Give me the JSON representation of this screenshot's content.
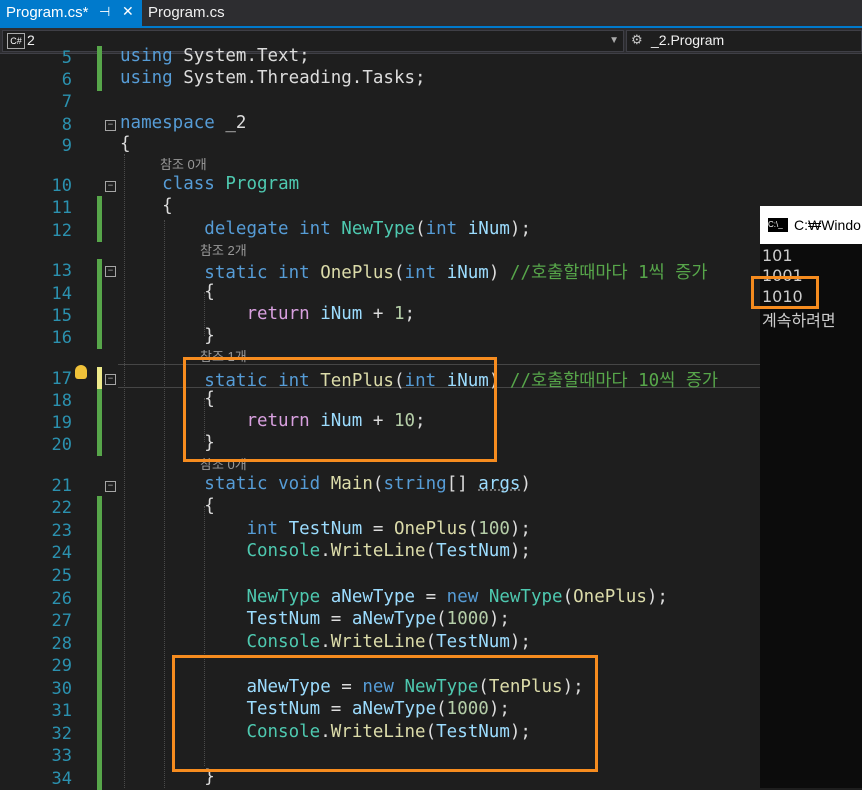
{
  "tabs": [
    {
      "label": "Program.cs*",
      "pin": "⊣",
      "close": "✕"
    },
    {
      "label": "Program.cs"
    }
  ],
  "nav": {
    "project_icon": "C#",
    "project": "2",
    "class_icon": "class-icon",
    "class_name": "_2.Program"
  },
  "lines": [
    {
      "n": "5",
      "parts": [
        [
          "kw",
          "using"
        ],
        [
          "plain",
          " System.Text;"
        ]
      ]
    },
    {
      "n": "6",
      "parts": [
        [
          "kw",
          "using"
        ],
        [
          "plain",
          " System.Threading.Tasks;"
        ]
      ]
    },
    {
      "n": "7",
      "parts": []
    },
    {
      "n": "8",
      "parts": [
        [
          "kw",
          "namespace"
        ],
        [
          "plain",
          " _2"
        ]
      ]
    },
    {
      "n": "9",
      "parts": [
        [
          "plain",
          "{"
        ]
      ]
    },
    {
      "n": "10",
      "parts": [
        [
          "plain",
          "    "
        ],
        [
          "kw",
          "class"
        ],
        [
          "plain",
          " "
        ],
        [
          "ty",
          "Program"
        ]
      ]
    },
    {
      "n": "11",
      "parts": [
        [
          "plain",
          "    {"
        ]
      ]
    },
    {
      "n": "12",
      "parts": [
        [
          "plain",
          "        "
        ],
        [
          "kw",
          "delegate"
        ],
        [
          "plain",
          " "
        ],
        [
          "kw",
          "int"
        ],
        [
          "plain",
          " "
        ],
        [
          "ty",
          "NewType"
        ],
        [
          "plain",
          "("
        ],
        [
          "kw",
          "int"
        ],
        [
          "plain",
          " "
        ],
        [
          "pm",
          "iNum"
        ],
        [
          "plain",
          ");"
        ]
      ]
    },
    {
      "n": "13",
      "parts": [
        [
          "plain",
          "        "
        ],
        [
          "kw",
          "static"
        ],
        [
          "plain",
          " "
        ],
        [
          "kw",
          "int"
        ],
        [
          "plain",
          " "
        ],
        [
          "fn",
          "OnePlus"
        ],
        [
          "plain",
          "("
        ],
        [
          "kw",
          "int"
        ],
        [
          "plain",
          " "
        ],
        [
          "pm",
          "iNum"
        ],
        [
          "plain",
          ") "
        ],
        [
          "cm",
          "//호출할때마다 1씩 증가"
        ]
      ]
    },
    {
      "n": "14",
      "parts": [
        [
          "plain",
          "        {"
        ]
      ]
    },
    {
      "n": "15",
      "parts": [
        [
          "plain",
          "            "
        ],
        [
          "ctl",
          "return"
        ],
        [
          "plain",
          " "
        ],
        [
          "pm",
          "iNum"
        ],
        [
          "plain",
          " + "
        ],
        [
          "num",
          "1"
        ],
        [
          "plain",
          ";"
        ]
      ]
    },
    {
      "n": "16",
      "parts": [
        [
          "plain",
          "        }"
        ]
      ]
    },
    {
      "n": "17",
      "parts": [
        [
          "plain",
          "        "
        ],
        [
          "kw",
          "static"
        ],
        [
          "plain",
          " "
        ],
        [
          "kw",
          "int"
        ],
        [
          "plain",
          " "
        ],
        [
          "fn",
          "TenPlus"
        ],
        [
          "plain",
          "("
        ],
        [
          "kw",
          "int"
        ],
        [
          "plain",
          " "
        ],
        [
          "pm",
          "iNum"
        ],
        [
          "plain",
          ") "
        ],
        [
          "cm",
          "//호출할때마다 10씩 증가"
        ]
      ]
    },
    {
      "n": "18",
      "parts": [
        [
          "plain",
          "        {"
        ]
      ]
    },
    {
      "n": "19",
      "parts": [
        [
          "plain",
          "            "
        ],
        [
          "ctl",
          "return"
        ],
        [
          "plain",
          " "
        ],
        [
          "pm",
          "iNum"
        ],
        [
          "plain",
          " + "
        ],
        [
          "num",
          "10"
        ],
        [
          "plain",
          ";"
        ]
      ]
    },
    {
      "n": "20",
      "parts": [
        [
          "plain",
          "        }"
        ]
      ]
    },
    {
      "n": "21",
      "parts": [
        [
          "plain",
          "        "
        ],
        [
          "kw",
          "static"
        ],
        [
          "plain",
          " "
        ],
        [
          "kw",
          "void"
        ],
        [
          "plain",
          " "
        ],
        [
          "fn",
          "Main"
        ],
        [
          "plain",
          "("
        ],
        [
          "kw",
          "string"
        ],
        [
          "plain",
          "[] "
        ],
        [
          "param",
          "args"
        ],
        [
          "plain",
          ")"
        ]
      ]
    },
    {
      "n": "22",
      "parts": [
        [
          "plain",
          "        {"
        ]
      ]
    },
    {
      "n": "23",
      "parts": [
        [
          "plain",
          "            "
        ],
        [
          "kw",
          "int"
        ],
        [
          "plain",
          " "
        ],
        [
          "pm",
          "TestNum"
        ],
        [
          "plain",
          " = "
        ],
        [
          "fn",
          "OnePlus"
        ],
        [
          "plain",
          "("
        ],
        [
          "num",
          "100"
        ],
        [
          "plain",
          ");"
        ]
      ]
    },
    {
      "n": "24",
      "parts": [
        [
          "plain",
          "            "
        ],
        [
          "ty",
          "Console"
        ],
        [
          "plain",
          "."
        ],
        [
          "fn",
          "WriteLine"
        ],
        [
          "plain",
          "("
        ],
        [
          "pm",
          "TestNum"
        ],
        [
          "plain",
          ");"
        ]
      ]
    },
    {
      "n": "25",
      "parts": []
    },
    {
      "n": "26",
      "parts": [
        [
          "plain",
          "            "
        ],
        [
          "ty",
          "NewType"
        ],
        [
          "plain",
          " "
        ],
        [
          "pm",
          "aNewType"
        ],
        [
          "plain",
          " = "
        ],
        [
          "kw",
          "new"
        ],
        [
          "plain",
          " "
        ],
        [
          "ty",
          "NewType"
        ],
        [
          "plain",
          "("
        ],
        [
          "fn",
          "OnePlus"
        ],
        [
          "plain",
          ");"
        ]
      ]
    },
    {
      "n": "27",
      "parts": [
        [
          "plain",
          "            "
        ],
        [
          "pm",
          "TestNum"
        ],
        [
          "plain",
          " = "
        ],
        [
          "pm",
          "aNewType"
        ],
        [
          "plain",
          "("
        ],
        [
          "num",
          "1000"
        ],
        [
          "plain",
          ");"
        ]
      ]
    },
    {
      "n": "28",
      "parts": [
        [
          "plain",
          "            "
        ],
        [
          "ty",
          "Console"
        ],
        [
          "plain",
          "."
        ],
        [
          "fn",
          "WriteLine"
        ],
        [
          "plain",
          "("
        ],
        [
          "pm",
          "TestNum"
        ],
        [
          "plain",
          ");"
        ]
      ]
    },
    {
      "n": "29",
      "parts": []
    },
    {
      "n": "30",
      "parts": [
        [
          "plain",
          "            "
        ],
        [
          "pm",
          "aNewType"
        ],
        [
          "plain",
          " = "
        ],
        [
          "kw",
          "new"
        ],
        [
          "plain",
          " "
        ],
        [
          "ty",
          "NewType"
        ],
        [
          "plain",
          "("
        ],
        [
          "fn",
          "TenPlus"
        ],
        [
          "plain",
          ");"
        ]
      ]
    },
    {
      "n": "31",
      "parts": [
        [
          "plain",
          "            "
        ],
        [
          "pm",
          "TestNum"
        ],
        [
          "plain",
          " = "
        ],
        [
          "pm",
          "aNewType"
        ],
        [
          "plain",
          "("
        ],
        [
          "num",
          "1000"
        ],
        [
          "plain",
          ");"
        ]
      ]
    },
    {
      "n": "32",
      "parts": [
        [
          "plain",
          "            "
        ],
        [
          "ty",
          "Console"
        ],
        [
          "plain",
          "."
        ],
        [
          "fn",
          "WriteLine"
        ],
        [
          "plain",
          "("
        ],
        [
          "pm",
          "TestNum"
        ],
        [
          "plain",
          ");"
        ]
      ]
    },
    {
      "n": "33",
      "parts": []
    },
    {
      "n": "34",
      "parts": [
        [
          "plain",
          "        }"
        ]
      ]
    }
  ],
  "lens": {
    "ref0_a": "참조 0개",
    "ref2": "참조 2개",
    "ref1": "참조 1개",
    "ref0_b": "참조 0개"
  },
  "console": {
    "title": "C:₩Windo",
    "icon": "C:\\_",
    "output": [
      "101",
      "1001",
      "1010",
      "계속하려면"
    ]
  }
}
